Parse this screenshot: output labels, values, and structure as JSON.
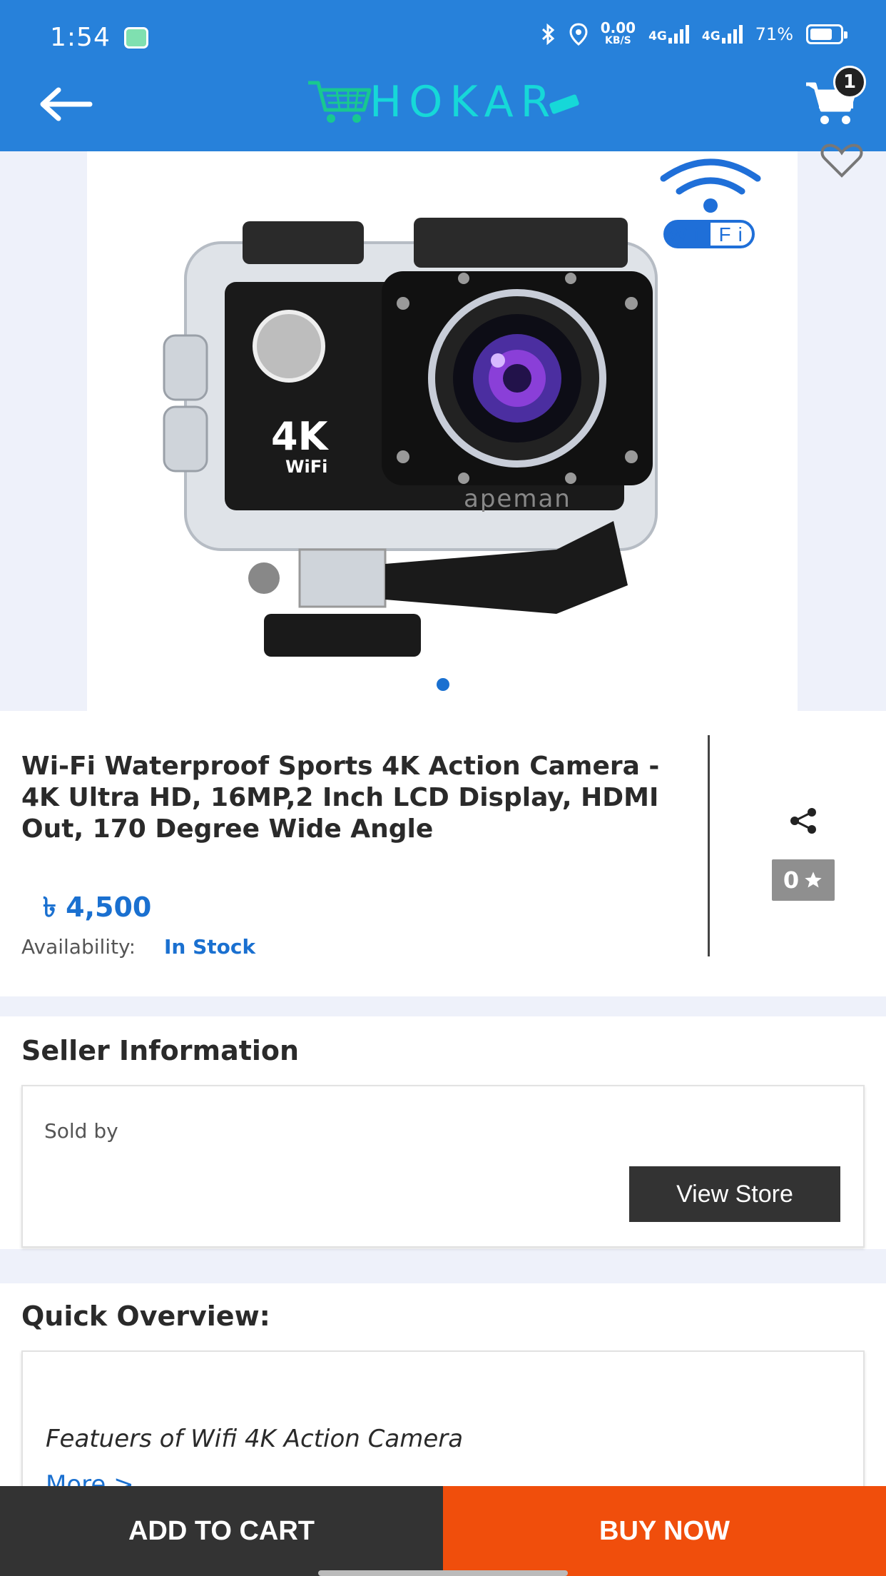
{
  "status_bar": {
    "time": "1:54",
    "net_speed_value": "0.00",
    "net_speed_unit": "KB/S",
    "sim1_label": "4G",
    "sim2_label": "4G",
    "battery": "71%"
  },
  "app_bar": {
    "logo_text": "HOKAR",
    "cart_count": "1"
  },
  "product": {
    "image_wifi_label": "Wi Fi",
    "image_brand": "apeman",
    "image_badge": "4K",
    "image_badge_sub": "WiFi",
    "title": "Wi-Fi Waterproof Sports 4K Action Camera - 4K Ultra HD, 16MP,2 Inch LCD Display, HDMI Out, 170 Degree Wide Angle",
    "price": "৳ 4,500",
    "availability_label": "Availability:",
    "availability_value": "In Stock",
    "rating": "0"
  },
  "seller": {
    "heading": "Seller Information",
    "sold_by": "Sold by",
    "view_store": "View Store"
  },
  "overview": {
    "heading": "Quick Overview:",
    "features": "Featuers of  Wifi 4K Action Camera",
    "more": "More >"
  },
  "actions": {
    "add_to_cart": "ADD TO CART",
    "buy_now": "BUY NOW"
  },
  "colors": {
    "app_bar": "#2781da",
    "accent_blue": "#1a70d0",
    "buy_now": "#f04e0c",
    "add_to_cart": "#333333"
  }
}
